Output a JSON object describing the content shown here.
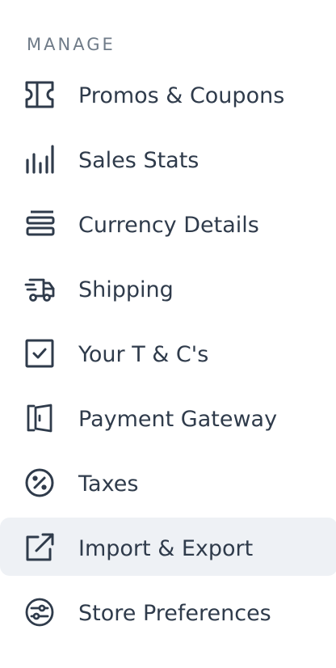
{
  "section": {
    "label": "MANAGE"
  },
  "menu": {
    "items": [
      {
        "label": "Promos & Coupons",
        "icon": "ticket-icon",
        "active": false
      },
      {
        "label": "Sales Stats",
        "icon": "bar-chart-icon",
        "active": false
      },
      {
        "label": "Currency Details",
        "icon": "stack-icon",
        "active": false
      },
      {
        "label": "Shipping",
        "icon": "truck-icon",
        "active": false
      },
      {
        "label": "Your T & C's",
        "icon": "checkbox-icon",
        "active": false
      },
      {
        "label": "Payment Gateway",
        "icon": "door-icon",
        "active": false
      },
      {
        "label": "Taxes",
        "icon": "percent-icon",
        "active": false
      },
      {
        "label": "Import & Export",
        "icon": "external-link-icon",
        "active": true
      },
      {
        "label": "Store Preferences",
        "icon": "sliders-icon",
        "active": false
      }
    ]
  },
  "colors": {
    "text": "#2f3b4b",
    "section_label": "#6f7b88",
    "active_background": "#eef1f5",
    "icon": "#2f3b4b"
  }
}
